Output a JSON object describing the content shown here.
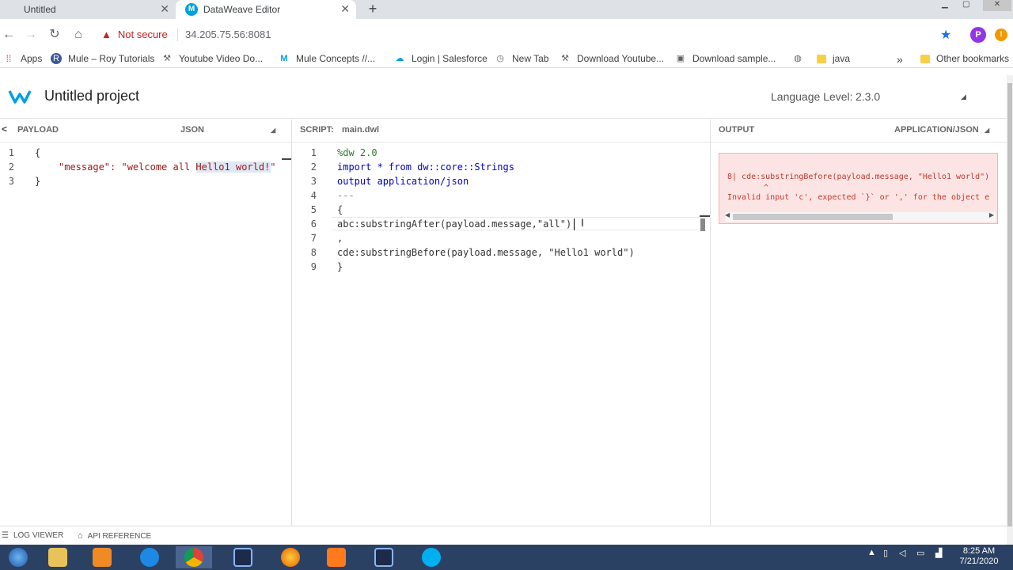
{
  "browser": {
    "tabs": [
      {
        "title": "Untitled"
      },
      {
        "title": "DataWeave Editor",
        "favicon": "M"
      }
    ],
    "security_label": "Not secure",
    "url": "34.205.75.56:8081",
    "profile_initial": "P",
    "bookmarks": [
      {
        "label": "Apps",
        "icon": "apps-grid-icon"
      },
      {
        "label": "Mule – Roy Tutorials",
        "icon": "r-icon"
      },
      {
        "label": "Youtube Video Do...",
        "icon": "hammer-icon"
      },
      {
        "label": "Mule Concepts //...",
        "icon": "mule-icon"
      },
      {
        "label": "Login | Salesforce",
        "icon": "salesforce-icon"
      },
      {
        "label": "New Tab",
        "icon": "history-icon"
      },
      {
        "label": "Download Youtube...",
        "icon": "hammer-icon"
      },
      {
        "label": "Download sample...",
        "icon": "page-icon"
      },
      {
        "label": "",
        "icon": "globe-icon"
      },
      {
        "label": "java",
        "icon": "folder-icon"
      },
      {
        "label": "Other bookmarks",
        "icon": "folder-icon"
      }
    ],
    "bookmarks_more": "»"
  },
  "app": {
    "project_title": "Untitled project",
    "language_level_label": "Language Level:",
    "language_level_value": "2.3.0"
  },
  "payload_pane": {
    "title": "PAYLOAD",
    "format": "JSON",
    "lines": [
      "1",
      "2",
      "3"
    ],
    "code": [
      "{",
      "\"message\": \"welcome all Hello1 world!\"",
      "}"
    ]
  },
  "script_pane": {
    "title": "SCRIPT:",
    "filename": "main.dwl",
    "line_numbers": [
      "1",
      "2",
      "3",
      "4",
      "5",
      "6",
      "7",
      "8",
      "9"
    ],
    "code": [
      "%dw 2.0",
      "import * from dw::core::Strings",
      "output application/json",
      "---",
      "{",
      "abc:substringAfter(payload.message,\"all\")",
      ",",
      "cde:substringBefore(payload.message, \"Hello1 world\")",
      "}"
    ]
  },
  "output_pane": {
    "title": "OUTPUT",
    "format": "APPLICATION/JSON",
    "error_line1": "8| cde:substringBefore(payload.message, \"Hello1 world\")",
    "error_caret": "^",
    "error_line2": "Invalid input 'c', expected `}` or ',' for the object e"
  },
  "bottom": {
    "log_viewer": "LOG VIEWER",
    "api_reference": "API REFERENCE"
  },
  "taskbar": {
    "time": "8:25 AM",
    "date": "7/21/2020"
  },
  "colors": {
    "accent": "#00a0df",
    "error_bg": "#fde4e4",
    "taskbar": "#2b4163"
  }
}
